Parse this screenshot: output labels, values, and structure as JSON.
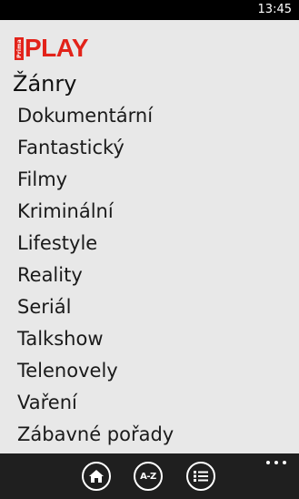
{
  "status_bar": {
    "time": "13:45"
  },
  "header": {
    "logo_small": "Prima",
    "logo_big": "PLAY"
  },
  "section": {
    "title": "Žánry"
  },
  "genres": [
    "Dokumentární",
    "Fantastický",
    "Filmy",
    "Kriminální",
    "Lifestyle",
    "Reality",
    "Seriál",
    "Talkshow",
    "Telenovely",
    "Vaření",
    "Zábavné pořady"
  ],
  "app_bar": {
    "buttons": [
      {
        "icon": "home-icon"
      },
      {
        "icon": "a-z-icon",
        "label": "A-Z"
      },
      {
        "icon": "list-icon"
      }
    ],
    "more_icon": "ellipsis-icon"
  }
}
